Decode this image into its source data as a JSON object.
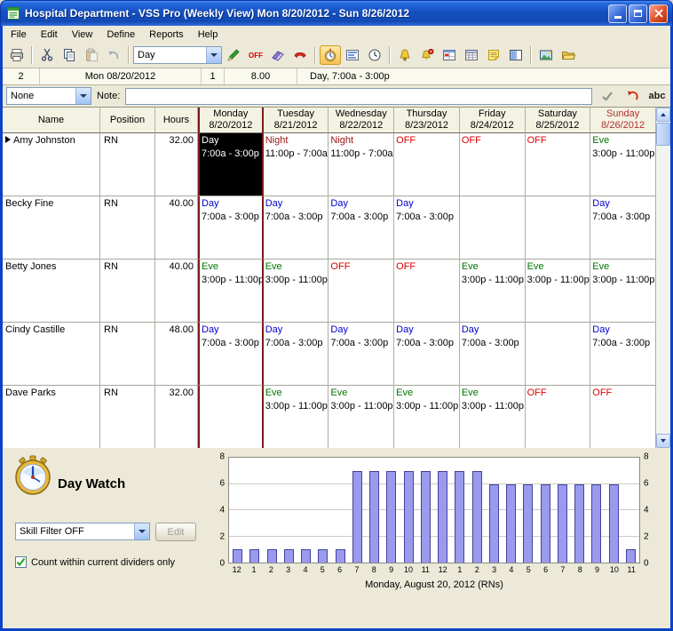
{
  "window": {
    "title": "Hospital Department - VSS Pro (Weekly View) Mon 8/20/2012 - Sun 8/26/2012"
  },
  "menu": {
    "items": [
      "File",
      "Edit",
      "View",
      "Define",
      "Reports",
      "Help"
    ]
  },
  "toolbar": {
    "shift_selector": {
      "value": "Day"
    },
    "off_button_label": "OFF",
    "icons": [
      "print-icon",
      "cut-icon",
      "copy-icon",
      "paste-icon",
      "undo-icon",
      "pencil-icon",
      "off-icon",
      "eraser-icon",
      "phone-icon",
      "daywatch-stopwatch-icon",
      "staffing-levels-icon",
      "clock-icon",
      "bell-icon",
      "alarm-icon",
      "schedule-icon",
      "calendar-grid-icon",
      "note-icon",
      "columns-icon",
      "photo-icon",
      "folder-icon"
    ]
  },
  "infobar": {
    "row_number": "2",
    "date": "Mon 08/20/2012",
    "shift_count": "1",
    "hours": "8.00",
    "cell_contents": "Day, 7:00a - 3:00p"
  },
  "notebar": {
    "filter_value": "None",
    "note_label": "Note:",
    "note_value": "",
    "spellcheck_label": "abc"
  },
  "schedule": {
    "columns": [
      "Name",
      "Position",
      "Hours"
    ],
    "days": [
      {
        "label": "Monday",
        "date": "8/20/2012",
        "selected": true
      },
      {
        "label": "Tuesday",
        "date": "8/21/2012"
      },
      {
        "label": "Wednesday",
        "date": "8/22/2012"
      },
      {
        "label": "Thursday",
        "date": "8/23/2012"
      },
      {
        "label": "Friday",
        "date": "8/24/2012"
      },
      {
        "label": "Saturday",
        "date": "8/25/2012"
      },
      {
        "label": "Sunday",
        "date": "8/26/2012",
        "highlight": "red"
      }
    ],
    "rows": [
      {
        "name": "Amy Johnston",
        "position": "RN",
        "hours": "32.00",
        "current": true,
        "shifts": [
          {
            "label": "Day",
            "time": "7:00a - 3:00p",
            "type": "day",
            "selected": true
          },
          {
            "label": "Night",
            "time": "11:00p - 7:00a",
            "type": "night"
          },
          {
            "label": "Night",
            "time": "11:00p - 7:00a",
            "type": "night"
          },
          {
            "label": "OFF",
            "time": "",
            "type": "off"
          },
          {
            "label": "OFF",
            "time": "",
            "type": "off"
          },
          {
            "label": "OFF",
            "time": "",
            "type": "off"
          },
          {
            "label": "Eve",
            "time": "3:00p - 11:00p",
            "type": "eve"
          }
        ]
      },
      {
        "name": "Becky Fine",
        "position": "RN",
        "hours": "40.00",
        "shifts": [
          {
            "label": "Day",
            "time": "7:00a - 3:00p",
            "type": "day"
          },
          {
            "label": "Day",
            "time": "7:00a - 3:00p",
            "type": "day"
          },
          {
            "label": "Day",
            "time": "7:00a - 3:00p",
            "type": "day"
          },
          {
            "label": "Day",
            "time": "7:00a - 3:00p",
            "type": "day"
          },
          null,
          null,
          {
            "label": "Day",
            "time": "7:00a - 3:00p",
            "type": "day"
          }
        ]
      },
      {
        "name": "Betty Jones",
        "position": "RN",
        "hours": "40.00",
        "shifts": [
          {
            "label": "Eve",
            "time": "3:00p - 11:00p",
            "type": "eve"
          },
          {
            "label": "Eve",
            "time": "3:00p - 11:00p",
            "type": "eve"
          },
          {
            "label": "OFF",
            "time": "",
            "type": "off"
          },
          {
            "label": "OFF",
            "time": "",
            "type": "off"
          },
          {
            "label": "Eve",
            "time": "3:00p - 11:00p",
            "type": "eve"
          },
          {
            "label": "Eve",
            "time": "3:00p - 11:00p",
            "type": "eve"
          },
          {
            "label": "Eve",
            "time": "3:00p - 11:00p",
            "type": "eve"
          }
        ]
      },
      {
        "name": "Cindy Castille",
        "position": "RN",
        "hours": "48.00",
        "shifts": [
          {
            "label": "Day",
            "time": "7:00a - 3:00p",
            "type": "day"
          },
          {
            "label": "Day",
            "time": "7:00a - 3:00p",
            "type": "day"
          },
          {
            "label": "Day",
            "time": "7:00a - 3:00p",
            "type": "day"
          },
          {
            "label": "Day",
            "time": "7:00a - 3:00p",
            "type": "day"
          },
          {
            "label": "Day",
            "time": "7:00a - 3:00p",
            "type": "day"
          },
          null,
          {
            "label": "Day",
            "time": "7:00a - 3:00p",
            "type": "day"
          }
        ]
      },
      {
        "name": "Dave Parks",
        "position": "RN",
        "hours": "32.00",
        "shifts": [
          null,
          {
            "label": "Eve",
            "time": "3:00p - 11:00p",
            "type": "eve"
          },
          {
            "label": "Eve",
            "time": "3:00p - 11:00p",
            "type": "eve"
          },
          {
            "label": "Eve",
            "time": "3:00p - 11:00p",
            "type": "eve"
          },
          {
            "label": "Eve",
            "time": "3:00p - 11:00p",
            "type": "eve"
          },
          {
            "label": "OFF",
            "time": "",
            "type": "off"
          },
          {
            "label": "OFF",
            "time": "",
            "type": "off"
          }
        ]
      }
    ]
  },
  "daywatch": {
    "title": "Day Watch",
    "skill_filter_value": "Skill Filter OFF",
    "edit_button_label": "Edit",
    "checkbox_label": "Count within current dividers only",
    "checkbox_checked": true
  },
  "chart_data": {
    "type": "bar",
    "title": "Monday, August 20, 2012 (RNs)",
    "x_labels": [
      "12",
      "1",
      "2",
      "3",
      "4",
      "5",
      "6",
      "7",
      "8",
      "9",
      "10",
      "11",
      "12",
      "1",
      "2",
      "3",
      "4",
      "5",
      "6",
      "7",
      "8",
      "9",
      "10",
      "11"
    ],
    "values": [
      1,
      1,
      1,
      1,
      1,
      1,
      1,
      7,
      7,
      7,
      7,
      7,
      7,
      7,
      7,
      6,
      6,
      6,
      6,
      6,
      6,
      6,
      6,
      1
    ],
    "ylim": [
      0,
      8
    ],
    "y_ticks": [
      0,
      2,
      4,
      6,
      8
    ],
    "grid": true,
    "legend": "none",
    "bar_color": "#9a9aee",
    "bar_border_color": "#43439b"
  },
  "colors": {
    "shift_day": "#0000cc",
    "shift_night": "#991111",
    "shift_eve": "#007700",
    "shift_off": "#dd0000",
    "sunday_header": "#b03030",
    "selected_cell_bg": "#000000",
    "monday_divider": "#7a1c1c"
  }
}
